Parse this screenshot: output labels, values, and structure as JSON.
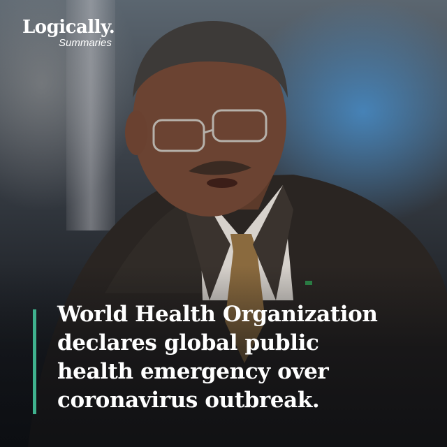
{
  "brand": {
    "name": "Logically.",
    "subtitle": "Summaries"
  },
  "headline": {
    "lines": [
      "World Health Organization",
      "declares global public",
      "health emergency over",
      "coronavirus outbreak."
    ]
  },
  "colors": {
    "accent": "#3fb28e",
    "text": "#ffffff",
    "background_blue": "#468cc8"
  }
}
